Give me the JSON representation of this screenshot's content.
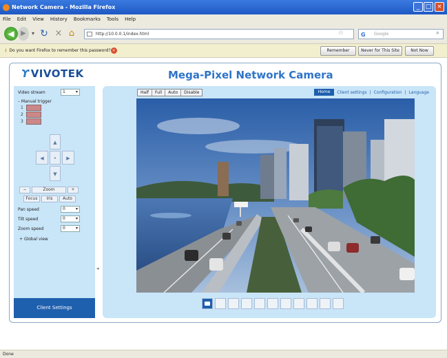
{
  "window": {
    "title": "Network Camera - Mozilla Firefox"
  },
  "menu": [
    "File",
    "Edit",
    "View",
    "History",
    "Bookmarks",
    "Tools",
    "Help"
  ],
  "nav": {
    "url": "http://10.0.0.1/index.html",
    "search_placeholder": "Google"
  },
  "notification": {
    "message": "Do you want Firefox to remember this password?",
    "remember": "Remember",
    "never": "Never for This Site",
    "not_now": "Not Now"
  },
  "page": {
    "logo": "VIVOTEK",
    "title": "Mega-Pixel Network Camera",
    "sidebar": {
      "video_stream_label": "Video stream",
      "video_stream_value": "1",
      "manual_trigger": "Manual trigger",
      "triggers": [
        "1",
        "2",
        "3"
      ],
      "pan_speed_label": "Pan speed",
      "pan_speed_value": "0",
      "tilt_speed_label": "Tilt speed",
      "tilt_speed_value": "0",
      "zoom_speed_label": "Zoom speed",
      "zoom_speed_value": "0",
      "global_view": "Global view",
      "zoom_label": "Zoom",
      "focus_label": "Focus",
      "iris_label": "Iris",
      "auto_label": "Auto",
      "footer": "Client Settings"
    },
    "view_sizes": [
      "Half",
      "Full",
      "Auto",
      "Disable"
    ],
    "nav_links": {
      "home": "Home",
      "client": "Client settings",
      "config": "Configuration",
      "language": "Language"
    },
    "toolbar_count": 11
  },
  "status": "Done"
}
